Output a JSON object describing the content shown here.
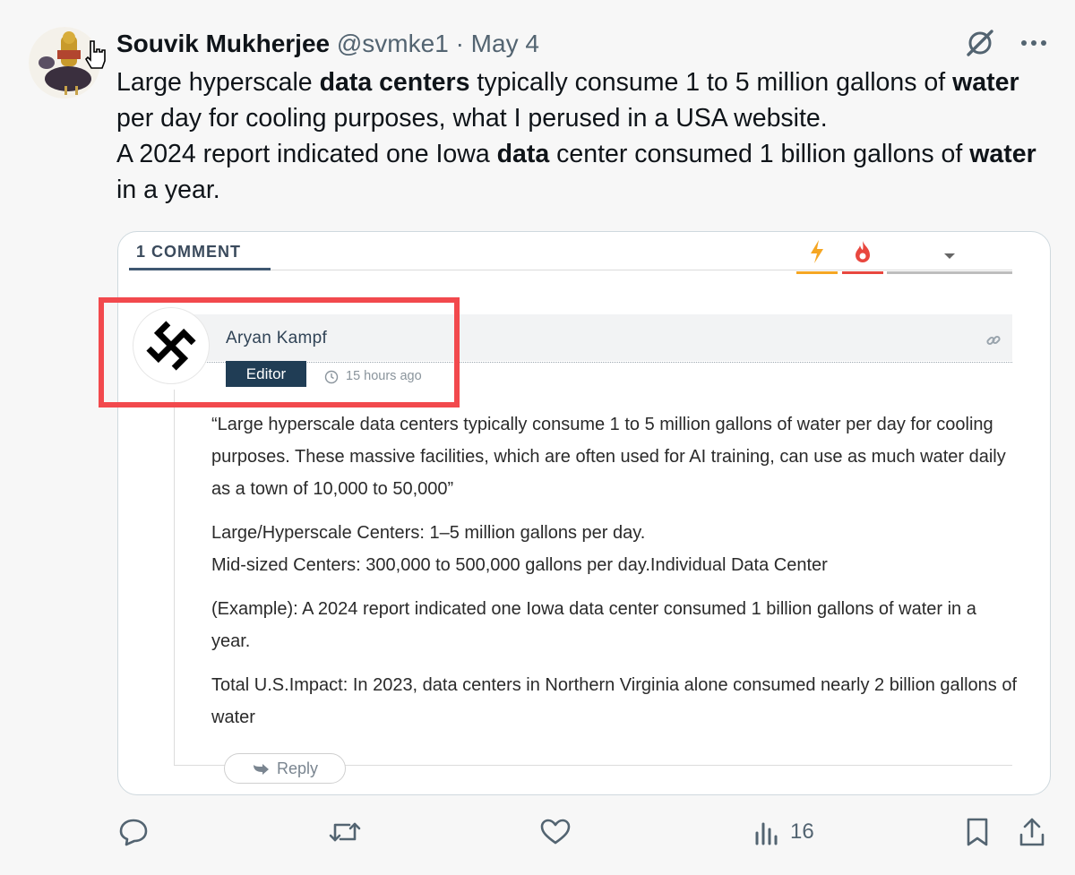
{
  "tweet": {
    "author_name": "Souvik Mukherjee",
    "handle": "@svmke1",
    "separator": "·",
    "date": "May 4",
    "text_segments": [
      {
        "text": "Large hyperscale ",
        "bold": false
      },
      {
        "text": "data centers",
        "bold": true
      },
      {
        "text": " typically consume 1 to 5 million gallons of ",
        "bold": false
      },
      {
        "text": "water",
        "bold": true
      },
      {
        "text": " per day for cooling purposes, what I perused in a USA website.",
        "bold": false
      },
      {
        "text": "\n",
        "bold": false
      },
      {
        "text": "A 2024 report indicated one Iowa ",
        "bold": false
      },
      {
        "text": "data",
        "bold": true
      },
      {
        "text": " center consumed 1 billion gallons of ",
        "bold": false
      },
      {
        "text": "water",
        "bold": true
      },
      {
        "text": " in a year.",
        "bold": false
      }
    ],
    "icons": {
      "top_right": [
        "grok-icon",
        "more-icon"
      ]
    }
  },
  "embedded": {
    "comments_count_label": "1 COMMENT",
    "tabs": {
      "bolt_color": "#f5a623",
      "fire_color": "#e8473f"
    },
    "comment": {
      "author": "Aryan Kampf",
      "badge": "Editor",
      "time": "15 hours ago",
      "paragraphs": [
        "“Large hyperscale data centers typically consume 1 to 5 million gallons of water per day for cooling purposes. These massive facilities, which are often used for AI training, can use as much water daily as a town of 10,000 to 50,000”",
        "Large/Hyperscale Centers: 1–5 million gallons per day.",
        "Mid-sized Centers: 300,000 to 500,000 gallons per day.Individual Data Center",
        "(Example): A 2024 report indicated one Iowa data center consumed 1 billion gallons of water in a year.",
        "Total U.S.Impact: In 2023, data centers in Northern Virginia alone consumed nearly 2 billion gallons of water"
      ],
      "reply_label": "Reply"
    },
    "highlight_color": "#f2494d"
  },
  "actions": {
    "views_count": "16"
  }
}
